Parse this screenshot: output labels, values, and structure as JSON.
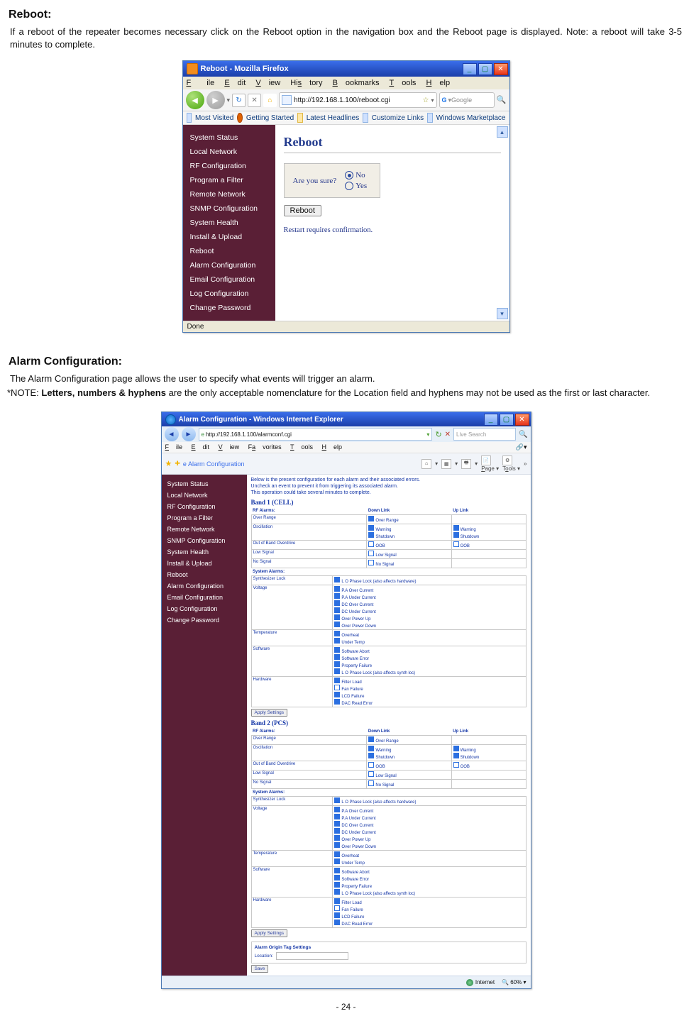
{
  "reboot_section": {
    "title": "Reboot:",
    "text": "If a reboot of the repeater becomes necessary click on the Reboot option in the navigation box and the Reboot page is displayed. Note: a reboot will take 3-5 minutes to complete."
  },
  "reboot_window": {
    "title": "Reboot - Mozilla Firefox",
    "menus": {
      "file": "File",
      "edit": "Edit",
      "view": "View",
      "history": "History",
      "bookmarks": "Bookmarks",
      "tools": "Tools",
      "help": "Help"
    },
    "url": "http://192.168.1.100/reboot.cgi",
    "search_placeholder": "Google",
    "bookmarks": {
      "most_visited": "Most Visited",
      "getting_started": "Getting Started",
      "latest_headlines": "Latest Headlines",
      "customize_links": "Customize Links",
      "windows_marketplace": "Windows Marketplace"
    },
    "sidebar": [
      "System Status",
      "Local Network",
      "RF Configuration",
      "Program a Filter",
      "Remote Network",
      "SNMP Configuration",
      "System Health",
      "Install & Upload",
      "Reboot",
      "Alarm Configuration",
      "Email Configuration",
      "Log Configuration",
      "Change Password"
    ],
    "heading": "Reboot",
    "prompt": "Are you sure?",
    "opt_no": "No",
    "opt_yes": "Yes",
    "button": "Reboot",
    "note": "Restart requires confirmation.",
    "status": "Done"
  },
  "alarm_section": {
    "title": "Alarm Configuration:",
    "intro": "The Alarm Configuration page allows the user to specify what events will trigger an alarm.",
    "note_prefix": "*NOTE:  ",
    "note_bold": "Letters, numbers & hyphens",
    "note_suffix": " are the only acceptable nomenclature for the Location field and hyphens may not be used as the first or last character."
  },
  "alarm_window": {
    "title": "Alarm Configuration - Windows Internet Explorer",
    "url": "http://192.168.1.100/alarmconf.cgi",
    "search": "Live Search",
    "menus": {
      "file": "File",
      "edit": "Edit",
      "view": "View",
      "favorites": "Favorites",
      "tools": "Tools",
      "help": "Help"
    },
    "tab": "Alarm Configuration",
    "tools_auto": {
      "page": "Page",
      "tools": "Tools"
    },
    "sidebar": [
      "System Status",
      "Local Network",
      "RF Configuration",
      "Program a Filter",
      "Remote Network",
      "SNMP Configuration",
      "System Health",
      "Install & Upload",
      "Reboot",
      "Alarm Configuration",
      "Email Configuration",
      "Log Configuration",
      "Change Password"
    ],
    "intro_lines": [
      "Below is the present configuration for each alarm and their associated errors.",
      "Uncheck an event to prevent it from triggering its associated alarm.",
      "This operation could take several minutes to complete."
    ],
    "band1": "Band 1 (CELL)",
    "band2": "Band 2 (PCS)",
    "cols": {
      "rf": "RF Alarms:",
      "down": "Down Link",
      "up": "Up Link"
    },
    "rows_rf": {
      "over": "Over Range",
      "osc": "Oscillation",
      "oob": "Out of Band Overdrive",
      "low": "Low Signal",
      "no": "No Signal"
    },
    "cells": {
      "over": "Over Range",
      "warn": "Warning",
      "shut": "Shutdown",
      "oob": "OOB",
      "low": "Low Signal",
      "nosig": "No Signal"
    },
    "sys_header": "System Alarms:",
    "rows_sys": {
      "synth": "Synthesizer Lock",
      "volt": "Voltage",
      "temp": "Temperature",
      "soft": "Software",
      "hard": "Hardware"
    },
    "sys": {
      "lo": "L O Phase Lock (also affects hardware)",
      "pa_over": "P.A Over Current",
      "pa_under": "P.A Under Current",
      "dc_over": "DC Over Current",
      "dc_under": "DC Under Current",
      "over_up": "Over Power Up",
      "over_down": "Over Power Down",
      "overheat": "Overheat",
      "under": "Under Temp",
      "sa": "Software Abort",
      "se": "Software Error",
      "pf": "Property Failure",
      "lo_sys": "L O Phase Lock (also affects synth loc)",
      "fl": "Filter Load",
      "fan": "Fan Failure",
      "lcd": "LCD Failure",
      "dac": "DAC Read Error"
    },
    "apply": "Apply Settings",
    "origin_head": "Alarm Origin Tag Settings",
    "location": "Location:",
    "save": "Save",
    "status_net": "Internet",
    "zoom": "60%"
  },
  "page_number": "- 24 -"
}
